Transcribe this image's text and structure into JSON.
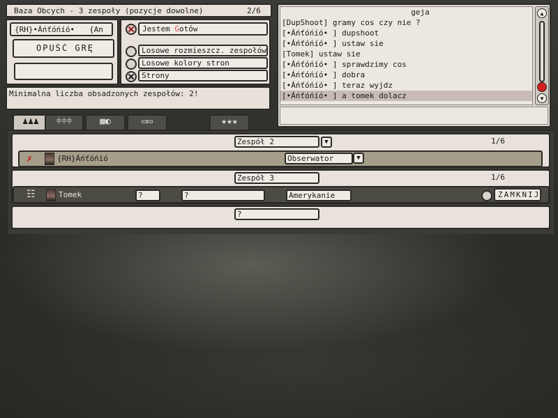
{
  "lobby": {
    "title": "Baza Obcych -   3 zespoły (pozycje dowolne)",
    "player_count": "2/6",
    "player_name": "{RH}•Áńťóńíó•",
    "player_tag": "{An",
    "leave_button": "OPUŚĆ GRĘ",
    "ready_prefix": "Jestem ",
    "ready_highlight": "G",
    "ready_suffix": "otów",
    "options": [
      {
        "label": "Losowe rozmieszcz. zespołów",
        "checked": false
      },
      {
        "label": "Losowe kolory stron",
        "checked": false
      },
      {
        "label": "Strony",
        "checked": true
      }
    ],
    "info_text": "Minimalna liczba obsadzonych zespołów: 2!"
  },
  "chat": {
    "header": "geja",
    "lines": [
      "[DupShoot] gramy cos czy nie ?",
      "[•Áńťóńíó•     ] dupshoot",
      "[•Áńťóńíó•     ] ustaw sie",
      "[Tomek] ustaw sie",
      "[•Áńťóńíó•     ] sprawdzimy cos",
      "[•Áńťóńíó•     ] dobra",
      "[•Áńťóńíó•     ] teraz wyjdz",
      "[•Áńťóńíó•     ] a tomek dolacz"
    ],
    "selected_index": 7
  },
  "tabs": [
    {
      "icon": "players-icon",
      "glyph": "♟♟♟",
      "active": true
    },
    {
      "icon": "sliders-icon",
      "glyph": "⫩⫩⫩",
      "active": false
    },
    {
      "icon": "map-icon",
      "glyph": "▦◐",
      "active": false
    },
    {
      "icon": "computers-icon",
      "glyph": "▭▭",
      "active": false
    },
    {
      "icon": "rank-stars-icon",
      "glyph": "★★★",
      "active": false
    }
  ],
  "teams": [
    {
      "name": "Zespół 2",
      "count": "1/6",
      "players": [
        {
          "tag_prefix": "{RH}",
          "name": "Áńťóńíó",
          "role": "Obserwator"
        }
      ]
    },
    {
      "name": "Zespół 3",
      "count": "1/6",
      "players": [
        {
          "name": "Tomek",
          "slot_a": "?",
          "slot_b": "?",
          "side": "Amerykanie",
          "close_label": "ZAMKNIJ"
        }
      ]
    }
  ],
  "empty_team_field": "?"
}
